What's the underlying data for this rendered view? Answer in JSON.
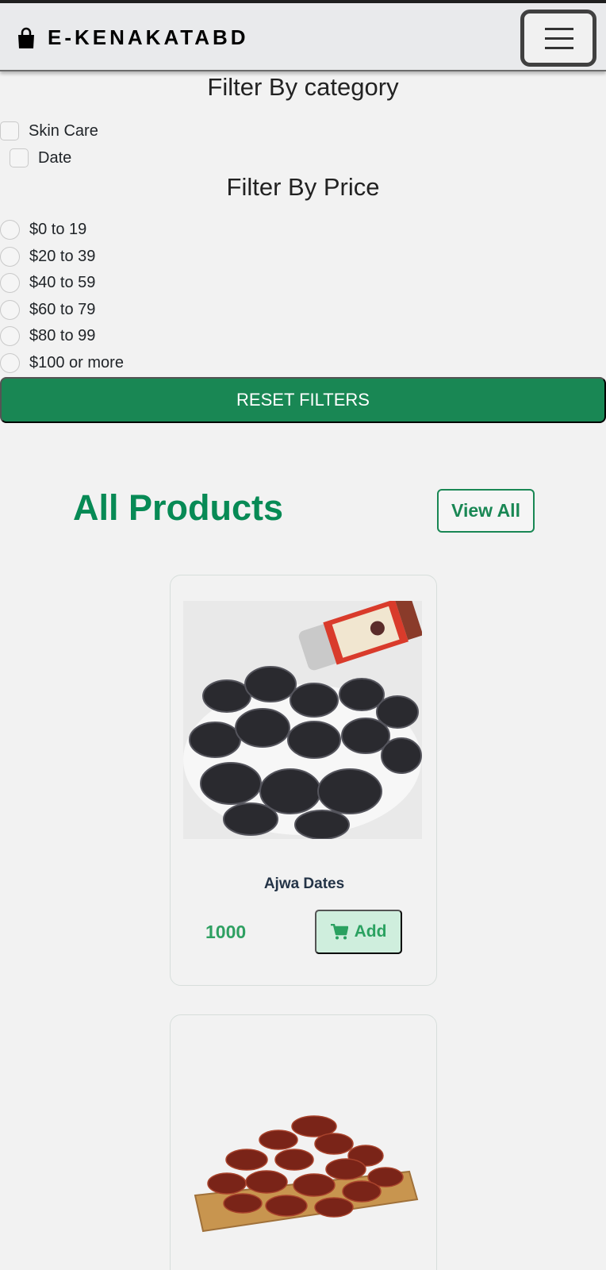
{
  "brand": {
    "name": "E-KENAKATABD",
    "icon": "shopping-bag-icon"
  },
  "menu": {
    "icon": "hamburger-menu-icon"
  },
  "filters": {
    "category": {
      "heading": "Filter By category",
      "options": [
        "Skin Care",
        "Date"
      ]
    },
    "price": {
      "heading": "Filter By Price",
      "options": [
        "$0 to 19",
        "$20 to 39",
        "$40 to 59",
        "$60 to 79",
        "$80 to 99",
        "$100 or more"
      ]
    },
    "reset_label": "RESET FILTERS"
  },
  "products_section": {
    "title": "All Products",
    "view_all_label": "View All"
  },
  "products": [
    {
      "name": "Ajwa Dates",
      "price": "1000",
      "add_label": "Add",
      "add_icon": "cart-icon",
      "image": "ajwa-dates-photo"
    },
    {
      "image": "medjool-dates-photo"
    }
  ],
  "colors": {
    "primary_green": "#198754",
    "title_green": "#078a55",
    "price_green": "#2fa062",
    "add_bg": "#cfeedd",
    "navbar_bg": "#e9eaec"
  }
}
